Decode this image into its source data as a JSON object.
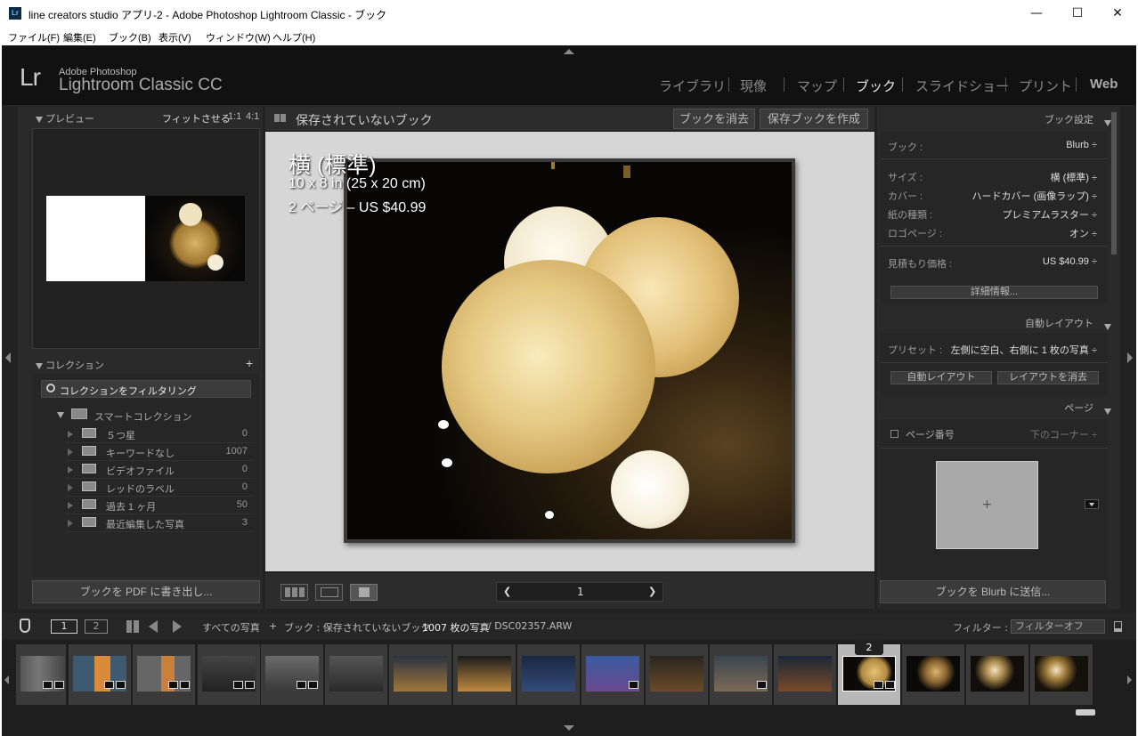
{
  "window": {
    "title": "line creators studio アプリ-2 - Adobe Photoshop Lightroom Classic - ブック",
    "app_icon": "Lr",
    "minimize_glyph": "—",
    "maximize_glyph": "☐",
    "close_glyph": "✕"
  },
  "menu": [
    "ファイル(F)",
    "編集(E)",
    "ブック(B)",
    "表示(V)",
    "ウィンドウ(W)",
    "ヘルプ(H)"
  ],
  "identity": {
    "lr": "Lr",
    "line1": "Adobe Photoshop",
    "line2": "Lightroom Classic CC",
    "modules": [
      "ライブラリ",
      "現像",
      "マップ",
      "ブック",
      "スライドショー",
      "プリント",
      "Web"
    ],
    "active_module": "ブック"
  },
  "left": {
    "preview_title": "プレビュー",
    "preview_opts": [
      "フィットさせる",
      "1:1",
      "4:1"
    ],
    "collections_title": "コレクション",
    "add_glyph": "+",
    "filter_label": "コレクションをフィルタリング",
    "smart_label": "スマートコレクション",
    "smart_items": [
      {
        "name": "５つ星",
        "count": "0"
      },
      {
        "name": "キーワードなし",
        "count": "1007"
      },
      {
        "name": "ビデオファイル",
        "count": "0"
      },
      {
        "name": "レッドのラベル",
        "count": "0"
      },
      {
        "name": "過去 1 ヶ月",
        "count": "50"
      },
      {
        "name": "最近編集した写真",
        "count": "3"
      }
    ],
    "export_pdf": "ブックを PDF に書き出し..."
  },
  "center": {
    "book_title": "保存されていないブック",
    "clear_btn": "ブックを消去",
    "create_btn": "保存ブックを作成",
    "overlay_title": "横 (標準)",
    "overlay_size": "10 x 8 in (25 x 20 cm)",
    "overlay_price": "2 ページ – US $40.99",
    "page_number": "1",
    "prev_glyph": "❮",
    "next_glyph": "❯"
  },
  "right": {
    "book_settings_title": "ブック設定",
    "book_label": "ブック :",
    "book_value": "Blurb ÷",
    "size_label": "サイズ :",
    "size_value": "横 (標準) ÷",
    "cover_label": "カバー :",
    "cover_value": "ハードカバー (画像ラップ) ÷",
    "paper_label": "紙の種類 :",
    "paper_value": "プレミアムラスター ÷",
    "logo_label": "ロゴページ :",
    "logo_value": "オン ÷",
    "estimate_label": "見積もり価格 :",
    "estimate_value": "US $40.99 ÷",
    "details_btn": "詳細情報...",
    "auto_layout_title": "自動レイアウト",
    "preset_label": "プリセット :",
    "preset_value": "左側に空白、右側に 1 枚の写真 ÷",
    "auto_layout_btn": "自動レイアウト",
    "clear_layout_btn": "レイアウトを消去",
    "page_title": "ページ",
    "page_number_label": "ページ番号",
    "page_number_value": "下のコーナー ÷",
    "plus_glyph": "+",
    "send_btn": "ブックを Blurb に送信..."
  },
  "filmstrip": {
    "screen1": "1",
    "screen2": "2",
    "source": "すべての写真",
    "book": "ブック : 保存されていないブック",
    "count": "1007 枚の写真",
    "file": "/ DSC02357.ARW",
    "filter_label": "フィルター :",
    "filter_value": "フィルターオフ",
    "selected_badge": "2"
  }
}
